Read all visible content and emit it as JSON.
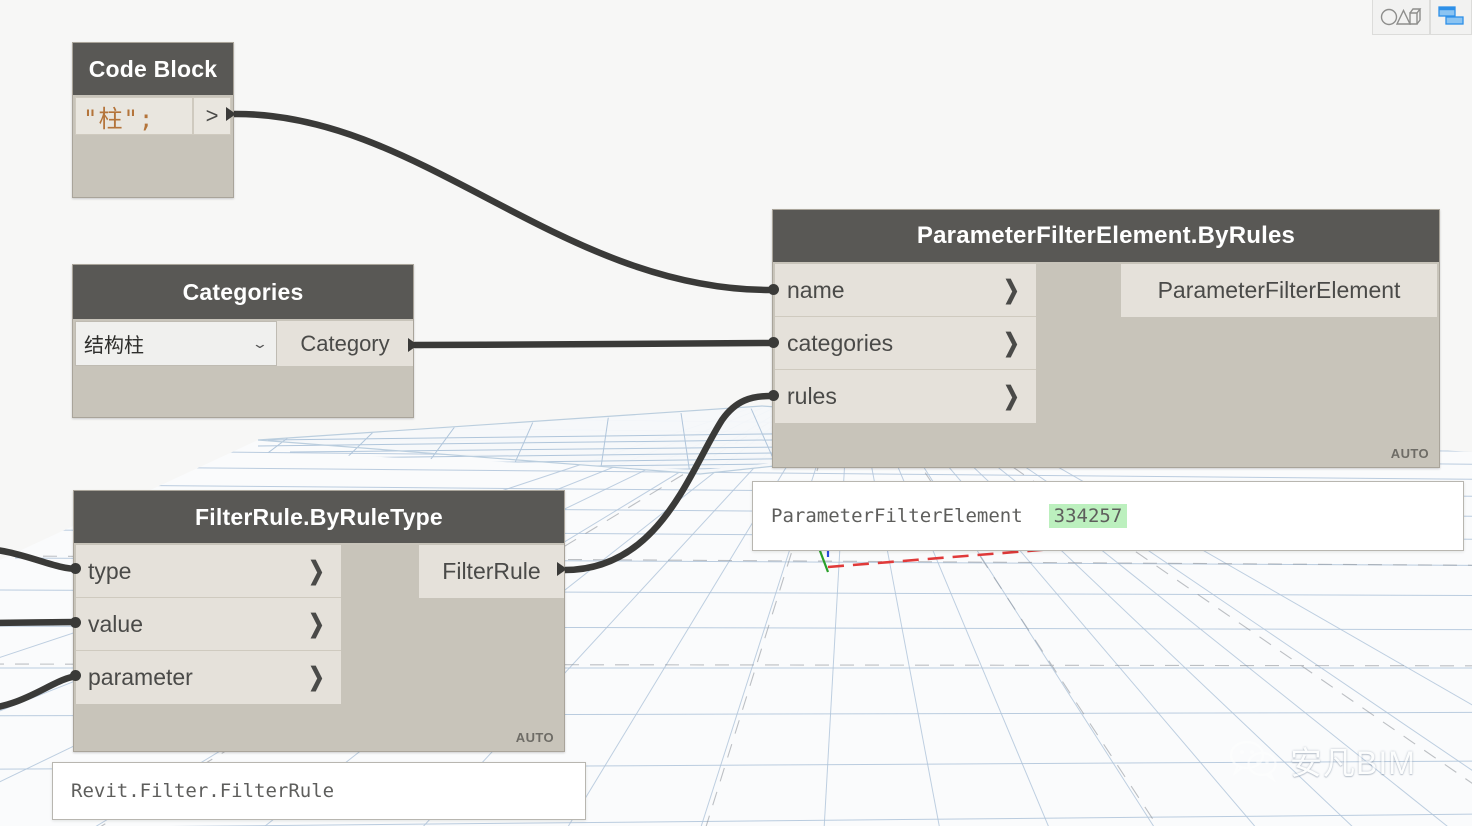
{
  "app": {
    "canvas_background": "#F7F7F6",
    "node_header_color": "#595855",
    "node_body_color": "#C8C4BA",
    "port_row_color": "#E5E1DA",
    "wire_color": "#3A3A38",
    "highlight_color": "#BCF0BE"
  },
  "toolbar": {
    "geometry_toggle_icon": "geometry-shapes-icon",
    "layout_icon": "panel-layout-icon"
  },
  "nodes": {
    "code_block": {
      "title": "Code Block",
      "code": "\"柱\";",
      "output_port_label": ">"
    },
    "categories": {
      "title": "Categories",
      "selected_value": "结构柱",
      "caret": "⌄",
      "output_label": "Category"
    },
    "filter_rule": {
      "title": "FilterRule.ByRuleType",
      "inputs": [
        {
          "label": "type",
          "chevron": "❯"
        },
        {
          "label": "value",
          "chevron": "❯"
        },
        {
          "label": "parameter",
          "chevron": "❯"
        }
      ],
      "output_label": "FilterRule",
      "execution_mode": "AUTO"
    },
    "parameter_filter": {
      "title": "ParameterFilterElement.ByRules",
      "inputs": [
        {
          "label": "name",
          "chevron": "❯"
        },
        {
          "label": "categories",
          "chevron": "❯"
        },
        {
          "label": "rules",
          "chevron": "❯"
        }
      ],
      "output_label": "ParameterFilterElement",
      "execution_mode": "AUTO"
    }
  },
  "previews": {
    "filter_rule_preview": {
      "text": "Revit.Filter.FilterRule"
    },
    "parameter_filter_preview": {
      "label": "ParameterFilterElement",
      "value": "334257"
    }
  },
  "watermark": {
    "text": "安凡BIM",
    "icon": "wechat-icon"
  }
}
